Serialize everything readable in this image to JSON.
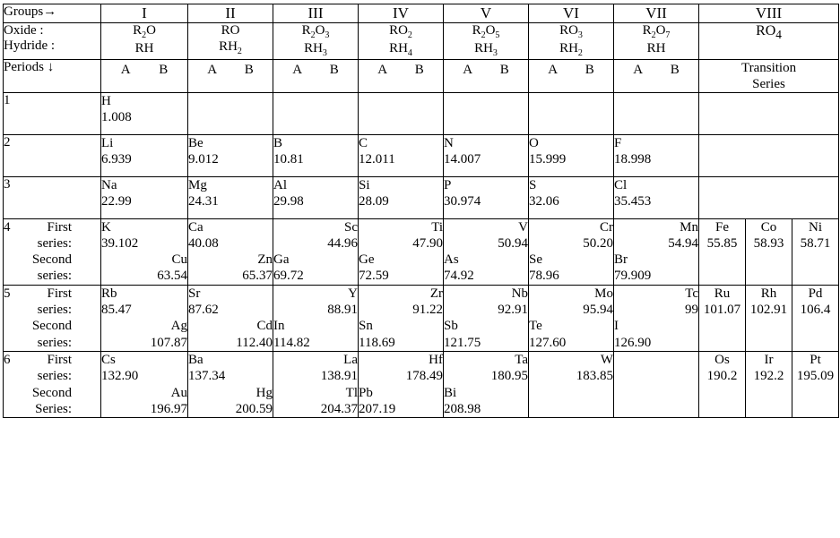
{
  "header": {
    "groups_label": "Groups→",
    "oxide_label": "Oxide :",
    "hydride_label": "Hydride :",
    "periods_label": "Periods ↓",
    "groups": [
      "I",
      "II",
      "III",
      "IV",
      "V",
      "VI",
      "VII",
      "VIII"
    ],
    "oxides": [
      "R2O",
      "RO",
      "R2O3",
      "RO2",
      "R2O5",
      "RO3",
      "R2O7"
    ],
    "hydrides": [
      "RH",
      "RH2",
      "RH3",
      "RH4",
      "RH3",
      "RH2",
      "RH"
    ],
    "group8_formula": "RO4",
    "sub_a": "A",
    "sub_b": "B",
    "transition_series_line1": "Transition",
    "transition_series_line2": "Series"
  },
  "labels": {
    "first_series_line1": "First",
    "first_series_line2": "series:",
    "second_series_line1": "Second",
    "second_series_line2": "series:",
    "second_series_cap_line1": "Second",
    "second_series_cap_line2": "Series:"
  },
  "periods": [
    {
      "number": "1",
      "cells": [
        {
          "symbol": "H",
          "mass": "1.008",
          "align": "left"
        },
        {
          "symbol": "",
          "mass": "",
          "align": "left"
        },
        {
          "symbol": "",
          "mass": "",
          "align": "left"
        },
        {
          "symbol": "",
          "mass": "",
          "align": "left"
        },
        {
          "symbol": "",
          "mass": "",
          "align": "left"
        },
        {
          "symbol": "",
          "mass": "",
          "align": "left"
        },
        {
          "symbol": "",
          "mass": "",
          "align": "left"
        }
      ]
    },
    {
      "number": "2",
      "cells": [
        {
          "symbol": "Li",
          "mass": "6.939",
          "align": "left"
        },
        {
          "symbol": "Be",
          "mass": "9.012",
          "align": "left"
        },
        {
          "symbol": "B",
          "mass": "10.81",
          "align": "left"
        },
        {
          "symbol": "C",
          "mass": "12.011",
          "align": "left"
        },
        {
          "symbol": "N",
          "mass": "14.007",
          "align": "left"
        },
        {
          "symbol": "O",
          "mass": "15.999",
          "align": "left"
        },
        {
          "symbol": "F",
          "mass": "18.998",
          "align": "left"
        }
      ]
    },
    {
      "number": "3",
      "cells": [
        {
          "symbol": "Na",
          "mass": "22.99",
          "align": "left"
        },
        {
          "symbol": "Mg",
          "mass": "24.31",
          "align": "left"
        },
        {
          "symbol": "Al",
          "mass": "29.98",
          "align": "left"
        },
        {
          "symbol": "Si",
          "mass": "28.09",
          "align": "left"
        },
        {
          "symbol": "P",
          "mass": "30.974",
          "align": "left"
        },
        {
          "symbol": "S",
          "mass": "32.06",
          "align": "left"
        },
        {
          "symbol": "Cl",
          "mass": "35.453",
          "align": "left"
        }
      ]
    }
  ],
  "period4": {
    "number": "4",
    "first": [
      {
        "symbol": "K",
        "mass": "39.102",
        "align": "left"
      },
      {
        "symbol": "Ca",
        "mass": "40.08",
        "align": "left"
      },
      {
        "symbol": "Sc",
        "mass": "44.96",
        "align": "right"
      },
      {
        "symbol": "Ti",
        "mass": "47.90",
        "align": "right"
      },
      {
        "symbol": "V",
        "mass": "50.94",
        "align": "right"
      },
      {
        "symbol": "Cr",
        "mass": "50.20",
        "align": "right"
      },
      {
        "symbol": "Mn",
        "mass": "54.94",
        "align": "right"
      }
    ],
    "second": [
      {
        "symbol": "Cu",
        "mass": "63.54",
        "align": "right"
      },
      {
        "symbol": "Zn",
        "mass": "65.37",
        "align": "right"
      },
      {
        "symbol": "Ga",
        "mass": "69.72",
        "align": "left"
      },
      {
        "symbol": "Ge",
        "mass": "72.59",
        "align": "left"
      },
      {
        "symbol": "As",
        "mass": "74.92",
        "align": "left"
      },
      {
        "symbol": "Se",
        "mass": "78.96",
        "align": "left"
      },
      {
        "symbol": "Br",
        "mass": "79.909",
        "align": "left"
      }
    ],
    "transition": [
      {
        "symbol": "Fe",
        "mass": "55.85"
      },
      {
        "symbol": "Co",
        "mass": "58.93"
      },
      {
        "symbol": "Ni",
        "mass": "58.71"
      }
    ]
  },
  "period5": {
    "number": "5",
    "first": [
      {
        "symbol": "Rb",
        "mass": "85.47",
        "align": "left"
      },
      {
        "symbol": "Sr",
        "mass": "87.62",
        "align": "left"
      },
      {
        "symbol": "Y",
        "mass": "88.91",
        "align": "right"
      },
      {
        "symbol": "Zr",
        "mass": "91.22",
        "align": "right"
      },
      {
        "symbol": "Nb",
        "mass": "92.91",
        "align": "right"
      },
      {
        "symbol": "Mo",
        "mass": "95.94",
        "align": "right"
      },
      {
        "symbol": "Tc",
        "mass": "99",
        "align": "right"
      }
    ],
    "second": [
      {
        "symbol": "Ag",
        "mass": "107.87",
        "align": "right"
      },
      {
        "symbol": "Cd",
        "mass": "112.40",
        "align": "right"
      },
      {
        "symbol": "In",
        "mass": "114.82",
        "align": "left"
      },
      {
        "symbol": "Sn",
        "mass": "118.69",
        "align": "left"
      },
      {
        "symbol": "Sb",
        "mass": "121.75",
        "align": "left"
      },
      {
        "symbol": "Te",
        "mass": "127.60",
        "align": "left"
      },
      {
        "symbol": "I",
        "mass": "126.90",
        "align": "left"
      }
    ],
    "transition": [
      {
        "symbol": "Ru",
        "mass": "101.07"
      },
      {
        "symbol": "Rh",
        "mass": "102.91"
      },
      {
        "symbol": "Pd",
        "mass": "106.4"
      }
    ]
  },
  "period6": {
    "number": "6",
    "first": [
      {
        "symbol": "Cs",
        "mass": "132.90",
        "align": "left"
      },
      {
        "symbol": "Ba",
        "mass": "137.34",
        "align": "left"
      },
      {
        "symbol": "La",
        "mass": "138.91",
        "align": "right"
      },
      {
        "symbol": "Hf",
        "mass": "178.49",
        "align": "right"
      },
      {
        "symbol": "Ta",
        "mass": "180.95",
        "align": "right"
      },
      {
        "symbol": "W",
        "mass": "183.85",
        "align": "right"
      },
      {
        "symbol": "",
        "mass": "",
        "align": "right"
      }
    ],
    "second": [
      {
        "symbol": "Au",
        "mass": "196.97",
        "align": "right"
      },
      {
        "symbol": "Hg",
        "mass": "200.59",
        "align": "right"
      },
      {
        "symbol": "Tl",
        "mass": "204.37",
        "align": "right"
      },
      {
        "symbol": "Pb",
        "mass": "207.19",
        "align": "left"
      },
      {
        "symbol": "Bi",
        "mass": "208.98",
        "align": "left"
      },
      {
        "symbol": "",
        "mass": "",
        "align": "left"
      },
      {
        "symbol": "",
        "mass": "",
        "align": "left"
      }
    ],
    "transition": [
      {
        "symbol": "Os",
        "mass": "190.2"
      },
      {
        "symbol": "Ir",
        "mass": "192.2"
      },
      {
        "symbol": "Pt",
        "mass": "195.09"
      }
    ]
  }
}
